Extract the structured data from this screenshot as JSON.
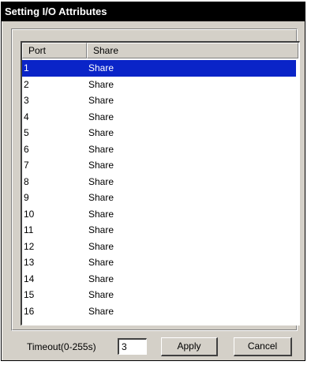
{
  "window": {
    "title": "Setting I/O Attributes"
  },
  "table": {
    "columns": [
      "Port",
      "Share"
    ],
    "rows": [
      {
        "port": "1",
        "share": "Share"
      },
      {
        "port": "2",
        "share": "Share"
      },
      {
        "port": "3",
        "share": "Share"
      },
      {
        "port": "4",
        "share": "Share"
      },
      {
        "port": "5",
        "share": "Share"
      },
      {
        "port": "6",
        "share": "Share"
      },
      {
        "port": "7",
        "share": "Share"
      },
      {
        "port": "8",
        "share": "Share"
      },
      {
        "port": "9",
        "share": "Share"
      },
      {
        "port": "10",
        "share": "Share"
      },
      {
        "port": "11",
        "share": "Share"
      },
      {
        "port": "12",
        "share": "Share"
      },
      {
        "port": "13",
        "share": "Share"
      },
      {
        "port": "14",
        "share": "Share"
      },
      {
        "port": "15",
        "share": "Share"
      },
      {
        "port": "16",
        "share": "Share"
      }
    ],
    "selected_row": "1"
  },
  "footer": {
    "timeout_label": "Timeout(0-255s)",
    "timeout_value": "3",
    "apply_label": "Apply",
    "cancel_label": "Cancel"
  },
  "colors": {
    "selection": "#0a24c8",
    "titlebar": "#000000",
    "dialog_bg": "#d4d0c8"
  }
}
